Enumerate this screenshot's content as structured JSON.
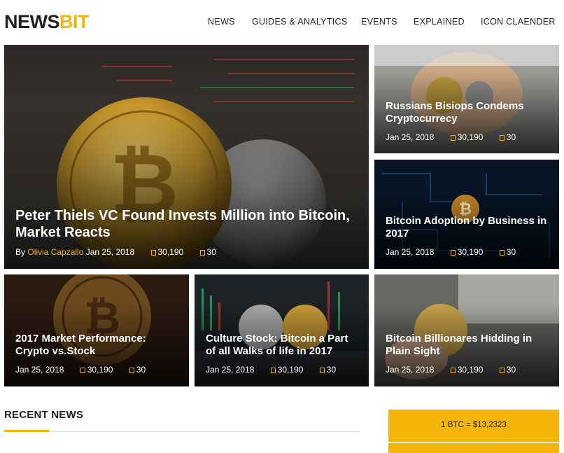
{
  "brand": {
    "part1": "NEWS",
    "part2": "BIT",
    "accent_color": "#f5b40a"
  },
  "nav": {
    "items": [
      {
        "label": "NEWS"
      },
      {
        "label": "GUIDES & ANALYTICS"
      },
      {
        "label": "EVENTS"
      },
      {
        "label": "EXPLAINED"
      },
      {
        "label": "ICON CLAENDER"
      }
    ]
  },
  "featured": {
    "title": "Peter Thiels VC Found Invests Million into Bitcoin, Market Reacts",
    "by": "By",
    "author": "Olivia Capzallo",
    "date": "Jan 25, 2018",
    "views": "30,190",
    "comments": "30"
  },
  "side_cards": [
    {
      "title": "Russians Bisiops Condems Cryptocurrecy",
      "date": "Jan 25, 2018",
      "views": "30,190",
      "comments": "30"
    },
    {
      "title": "Bitcoin Adoption by Business in 2017",
      "date": "Jan 25, 2018",
      "views": "30,190",
      "comments": "30"
    }
  ],
  "bottom_cards": [
    {
      "title": "2017 Market Performance: Crypto vs.Stock",
      "date": "Jan 25, 2018",
      "views": "30,190",
      "comments": "30"
    },
    {
      "title": "Culture Stock: Bitcoin a Part of all Walks of life in 2017",
      "date": "Jan 25, 2018",
      "views": "30,190",
      "comments": "30"
    },
    {
      "title": "Bitcoin Billionares Hidding in Plain Sight",
      "date": "Jan 25, 2018",
      "views": "30,190",
      "comments": "30"
    }
  ],
  "recent": {
    "heading": "RECENT NEWS"
  },
  "ticker": {
    "text": "1 BTC = $13,2323"
  }
}
